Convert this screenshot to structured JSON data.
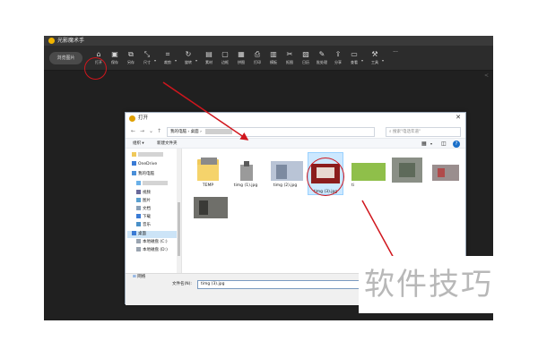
{
  "app": {
    "title": "光影魔术手",
    "browse_label": "浏览图片",
    "tools": [
      {
        "label": "打开",
        "icon": "folder-open-icon",
        "glyph": "⌂",
        "dd": false
      },
      {
        "label": "保存",
        "icon": "save-icon",
        "glyph": "▣",
        "dd": false
      },
      {
        "label": "另存",
        "icon": "save-as-icon",
        "glyph": "⧉",
        "dd": false
      },
      {
        "label": "尺寸",
        "icon": "resize-icon",
        "glyph": "⤡",
        "dd": true
      },
      {
        "label": "裁剪",
        "icon": "crop-icon",
        "glyph": "⌗",
        "dd": true
      },
      {
        "label": "旋转",
        "icon": "rotate-icon",
        "glyph": "↻",
        "dd": true
      },
      {
        "label": "素材",
        "icon": "material-icon",
        "glyph": "▤",
        "dd": false
      },
      {
        "label": "边框",
        "icon": "border-icon",
        "glyph": "▢",
        "dd": false
      },
      {
        "label": "拼图",
        "icon": "collage-icon",
        "glyph": "▦",
        "dd": false
      },
      {
        "label": "打印",
        "icon": "print-icon",
        "glyph": "⎙",
        "dd": false
      },
      {
        "label": "模板",
        "icon": "template-icon",
        "glyph": "▥",
        "dd": false
      },
      {
        "label": "抠图",
        "icon": "cutout-icon",
        "glyph": "✂",
        "dd": false
      },
      {
        "label": "日历",
        "icon": "calendar-icon",
        "glyph": "▧",
        "dd": false
      },
      {
        "label": "批处理",
        "icon": "batch-icon",
        "glyph": "✎",
        "dd": false
      },
      {
        "label": "分享",
        "icon": "share-icon",
        "glyph": "⇪",
        "dd": false
      },
      {
        "label": "查看",
        "icon": "view-icon",
        "glyph": "▭",
        "dd": true
      },
      {
        "label": "工具",
        "icon": "tools-icon",
        "glyph": "⚒",
        "dd": true
      }
    ],
    "more_label": "···"
  },
  "dialog": {
    "title": "打开",
    "close": "✕",
    "address": [
      "我的电脑",
      "桌面"
    ],
    "search_placeholder": "搜索\"电话年道\"",
    "organize": "组织 ▾",
    "new_folder": "新建文件夹",
    "nav_items": [
      {
        "label": "",
        "icon": "folder-icon"
      },
      {
        "label": "OneDrive",
        "icon": "cloud-icon"
      },
      {
        "label": "我的电脑",
        "icon": "computer-icon"
      },
      {
        "label": "",
        "icon": "user-icon"
      },
      {
        "label": "视频",
        "icon": "video-icon"
      },
      {
        "label": "图片",
        "icon": "picture-icon"
      },
      {
        "label": "文档",
        "icon": "document-icon"
      },
      {
        "label": "下载",
        "icon": "download-icon"
      },
      {
        "label": "音乐",
        "icon": "music-icon"
      },
      {
        "label": "桌面",
        "icon": "desktop-icon"
      },
      {
        "label": "本地磁盘 (C:)",
        "icon": "drive-icon"
      },
      {
        "label": "本地磁盘 (D:)",
        "icon": "drive-icon"
      }
    ],
    "network": "网络",
    "files": [
      {
        "name": "TEMP"
      },
      {
        "name": "timg (1).jpg"
      },
      {
        "name": "timg (2).jpg"
      },
      {
        "name": "timg (3).jpg"
      },
      {
        "name": "ti"
      },
      {
        "name": ""
      },
      {
        "name": ""
      },
      {
        "name": ""
      }
    ],
    "filename_label": "文件名(N):",
    "filename_value": "timg (3).jpg"
  },
  "watermark": "软件技巧",
  "colors": {
    "accent_red": "#d0161d",
    "selection": "#cce8ff",
    "app_bg": "#202020"
  }
}
